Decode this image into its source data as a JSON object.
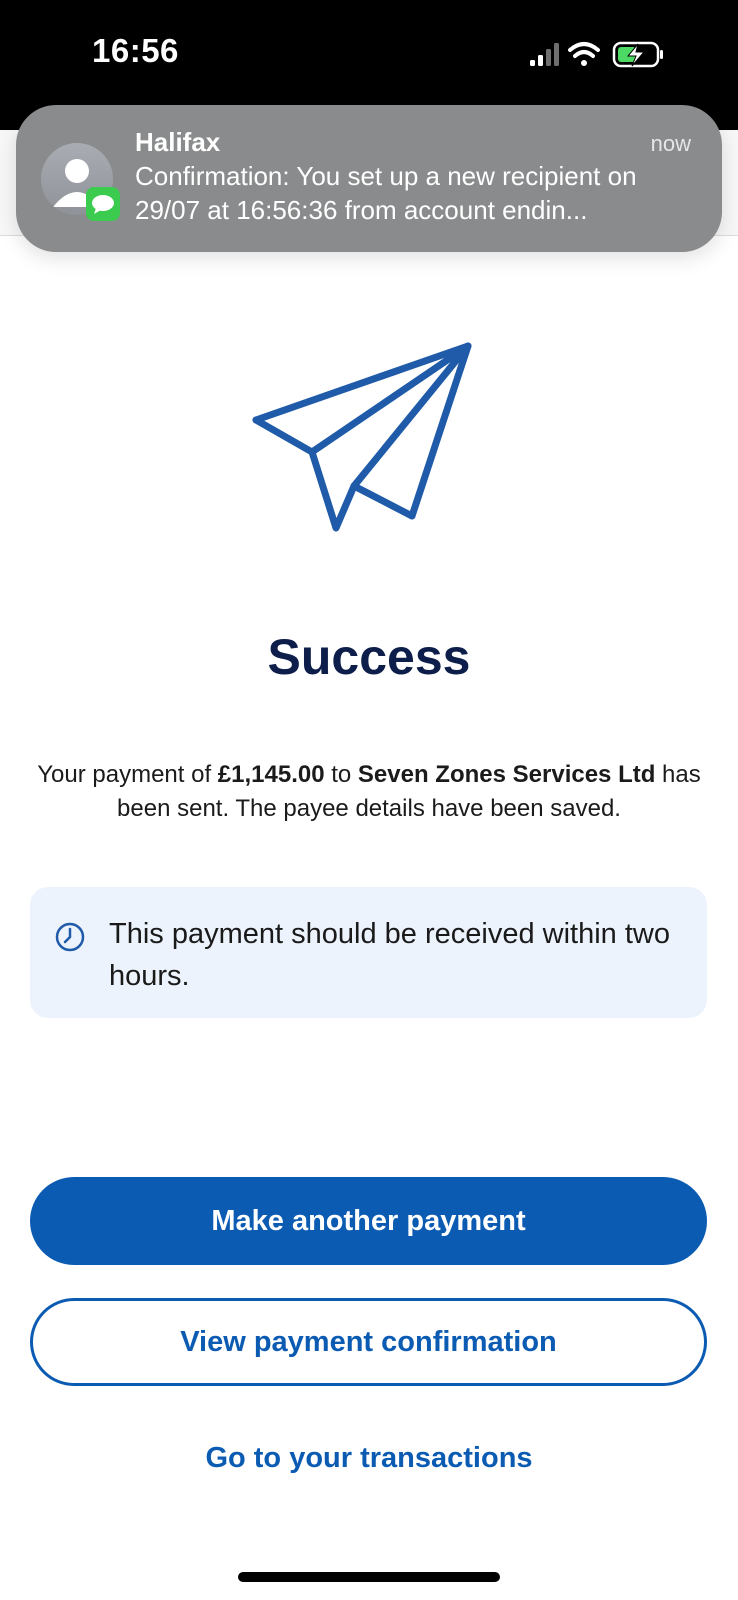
{
  "status_bar": {
    "time": "16:56",
    "icons": [
      "signal-icon",
      "wifi-icon",
      "battery-charging-icon"
    ]
  },
  "notification": {
    "app": "Halifax",
    "time": "now",
    "body": "Confirmation: You set up a new recipient on 29/07 at 16:56:36 from account endin...",
    "icons": [
      "contact-avatar-icon",
      "messages-badge-icon"
    ]
  },
  "main": {
    "hero_icon": "paper-plane-icon",
    "title": "Success",
    "message": {
      "part1": "Your payment of ",
      "amount": "£1,145.00",
      "part2": " to ",
      "payee": "Seven Zones Services Ltd",
      "part3": " has been sent. The payee details have been saved."
    },
    "info": {
      "icon": "clock-icon",
      "text": "This payment should be received within two hours."
    }
  },
  "actions": {
    "primary": "Make another payment",
    "secondary": "View payment confirmation",
    "link": "Go to your transactions"
  },
  "colors": {
    "brand_blue": "#0b5bb3",
    "title_navy": "#0c1e49",
    "info_bg": "#edf3fd",
    "battery_green": "#4cd964"
  }
}
